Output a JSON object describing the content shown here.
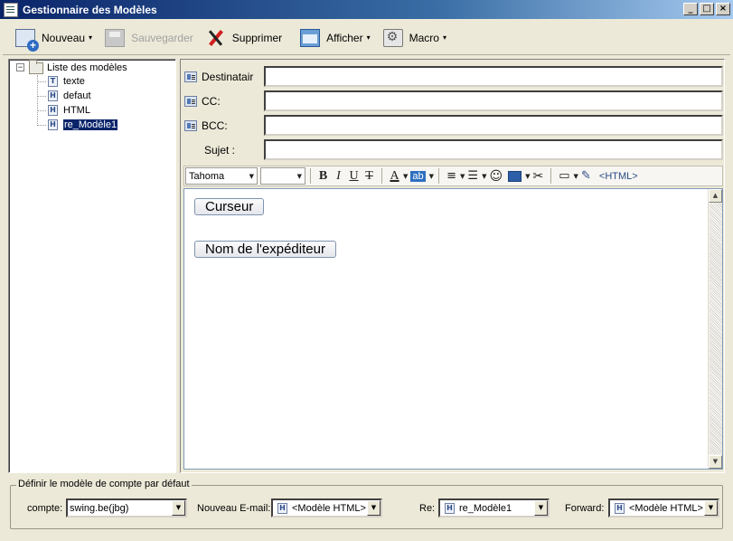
{
  "window": {
    "title": "Gestionnaire des Modèles",
    "buttons": {
      "minimize": "_",
      "maximize": "□",
      "close": "×"
    }
  },
  "toolbar": {
    "new_label": "Nouveau",
    "save_label": "Sauvegarder",
    "delete_label": "Supprimer",
    "view_label": "Afficher",
    "macro_label": "Macro",
    "dropdown_glyph": "▾"
  },
  "tree": {
    "expander": "−",
    "root_label": "Liste des modèles",
    "items": [
      {
        "type_letter": "T",
        "label": "texte"
      },
      {
        "type_letter": "H",
        "label": "defaut"
      },
      {
        "type_letter": "H",
        "label": "HTML"
      },
      {
        "type_letter": "H",
        "label": "re_Modèle1",
        "selected": true
      }
    ]
  },
  "fields": {
    "recipient_label": "Destinatair",
    "cc_label": "CC:",
    "bcc_label": "BCC:",
    "subject_label": "Sujet :"
  },
  "editor_toolbar": {
    "font": "Tahoma",
    "bold": "B",
    "italic": "I",
    "underline": "U",
    "strike": "T",
    "font_color": "A",
    "highlight": "ab",
    "html_tag": "<HTML>"
  },
  "editor": {
    "macros": [
      "Curseur",
      "Nom de l'expéditeur"
    ]
  },
  "bottom": {
    "group_title": "Définir le modèle de compte par défaut",
    "account_label": "compte:",
    "account_value": "swing.be(jbg)",
    "new_email_label": "Nouveau E-mail:",
    "new_email_value": "<Modèle HTML>",
    "re_label": "Re:",
    "re_value": "re_Modèle1",
    "forward_label": "Forward:",
    "forward_value": "<Modèle HTML>",
    "template_letter": "H"
  },
  "colors": {
    "title_bar": "#0a246a",
    "selection": "#0a246a",
    "window_bg": "#ece9d8"
  }
}
